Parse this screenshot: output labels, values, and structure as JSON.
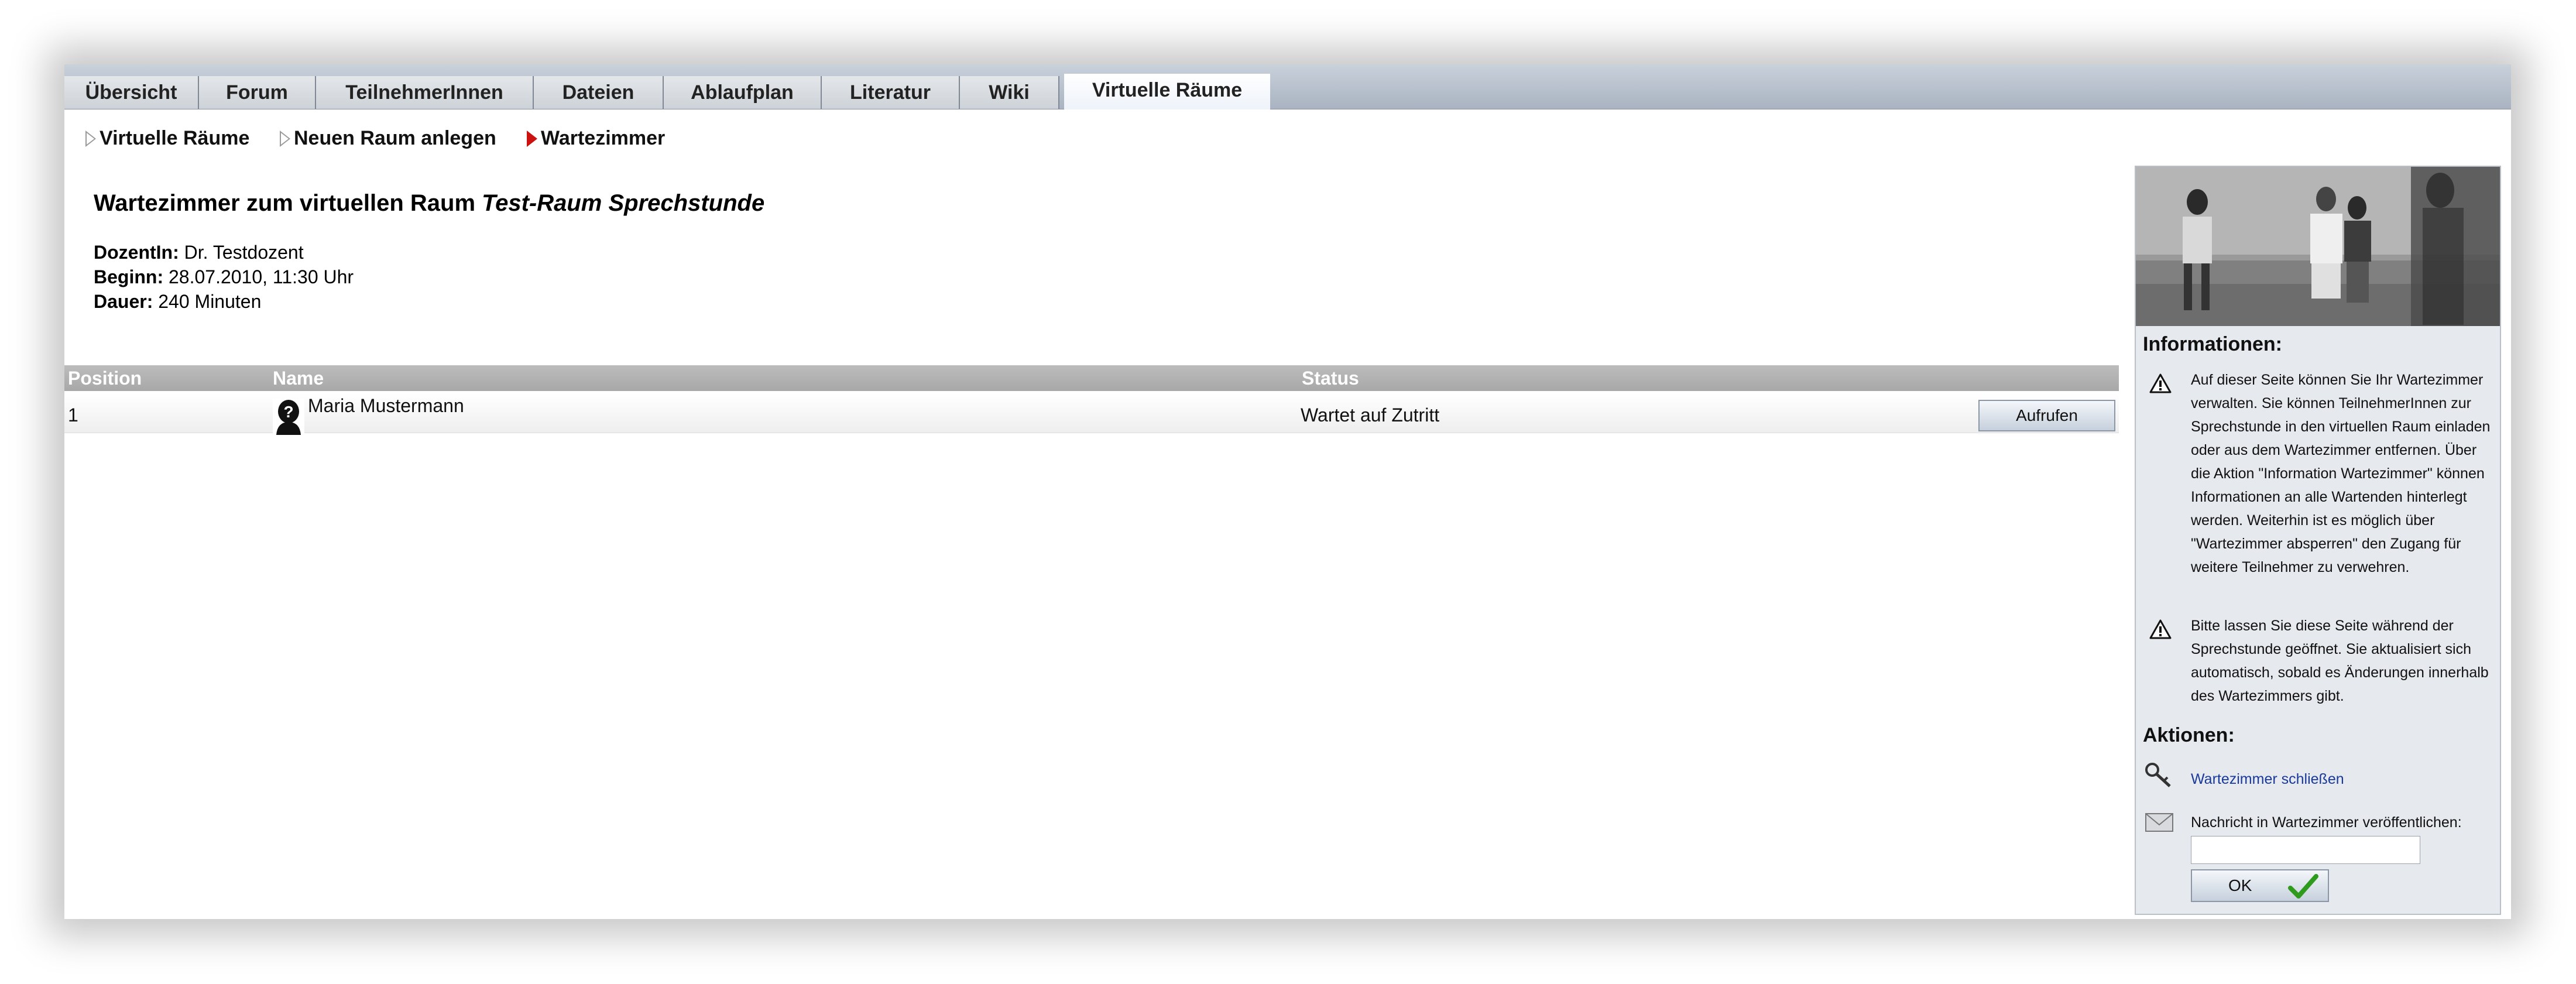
{
  "tabs": [
    {
      "label": "Übersicht",
      "active": false
    },
    {
      "label": "Forum",
      "active": false
    },
    {
      "label": "TeilnehmerInnen",
      "active": false
    },
    {
      "label": "Dateien",
      "active": false
    },
    {
      "label": "Ablaufplan",
      "active": false
    },
    {
      "label": "Literatur",
      "active": false
    },
    {
      "label": "Wiki",
      "active": false
    },
    {
      "label": "Virtuelle Räume",
      "active": true
    }
  ],
  "subnav": [
    {
      "label": "Virtuelle Räume",
      "current": false
    },
    {
      "label": "Neuen Raum anlegen",
      "current": false
    },
    {
      "label": "Wartezimmer",
      "current": true
    }
  ],
  "page": {
    "title_prefix": "Wartezimmer zum virtuellen Raum",
    "room_name": "Test-Raum Sprechstunde",
    "lecturer_label": "DozentIn:",
    "lecturer": "Dr. Testdozent",
    "start_label": "Beginn:",
    "start": "28.07.2010, 11:30 Uhr",
    "duration_label": "Dauer:",
    "duration": "240 Minuten"
  },
  "table": {
    "headers": {
      "position": "Position",
      "name": "Name",
      "status": "Status"
    },
    "rows": [
      {
        "position": "1",
        "name": "Maria Mustermann",
        "status": "Wartet auf Zutritt",
        "action": "Aufrufen"
      }
    ]
  },
  "sidebar": {
    "info_heading": "Informationen:",
    "info_1": "Auf dieser Seite können Sie Ihr Wartezimmer verwalten. Sie können TeilnehmerInnen zur Sprechstunde in den virtuellen Raum einladen oder aus dem Wartezimmer entfernen. Über die Aktion \"Information Wartezimmer\" können Informationen an alle Wartenden hinterlegt werden. Weiterhin ist es möglich über \"Wartezimmer absperren\" den Zugang für weitere Teilnehmer zu verwehren.",
    "info_2": "Bitte lassen Sie diese Seite während der Sprechstunde geöffnet. Sie aktualisiert sich automatisch, sobald es Änderungen innerhalb des Wartezimmers gibt.",
    "actions_heading": "Aktionen:",
    "close_link": "Wartezimmer schließen",
    "message_label": "Nachricht in Wartezimmer veröffentlichen:",
    "message_value": "",
    "ok_label": "OK"
  },
  "colors": {
    "accent_link": "#1a3a9a",
    "active_marker": "#cc1111",
    "check_green": "#2e9a1e"
  },
  "icons": {
    "avatar": "avatar-icon",
    "warning": "warning-icon",
    "key": "key-icon",
    "envelope": "envelope-icon",
    "check": "checkmark-icon"
  }
}
